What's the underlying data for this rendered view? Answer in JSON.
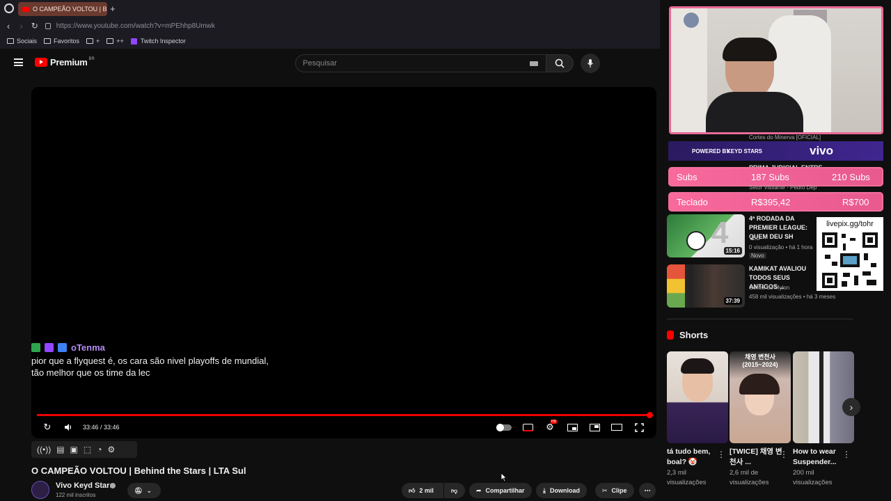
{
  "browser": {
    "tab_title": "O CAMPEÃO VOLTOU | Be",
    "new_tab": "+",
    "url": "https://www.youtube.com/watch?v=mPEhhp8Umwk",
    "bookmarks": [
      {
        "label": "Sociais"
      },
      {
        "label": "Favoritos"
      },
      {
        "label": "+"
      },
      {
        "label": "++"
      },
      {
        "label": "Twitch Inspector"
      }
    ]
  },
  "masthead": {
    "brand": "Premium",
    "region": "BR",
    "search_placeholder": "Pesquisar"
  },
  "player": {
    "chat_user": "oTenma",
    "chat_message": "pior que a flyquest é, os cara são nivel playoffs de mundial, tão melhor que os time da lec",
    "time": "33:46 / 33:46",
    "progress": 1.0,
    "settings_badge": "HD"
  },
  "video": {
    "title": "O CAMPEÃO VOLTOU | Behind the Stars | LTA Sul",
    "channel": "Vivo Keyd Stars",
    "subscribers": "122 mil inscritos",
    "likes": "2 mil",
    "share": "Compartilhar",
    "download": "Download",
    "clip": "Clipe"
  },
  "overlay": {
    "sponsor_left": "POWERED BY",
    "sponsor_mid": "KEYD STARS",
    "sponsor_right": "vivo",
    "subs_label": "Subs",
    "subs_current": "187 Subs",
    "subs_goal": "210 Subs",
    "goal_label": "Teclado",
    "goal_current": "R$395,42",
    "goal_target": "R$700",
    "qr_text": "livepix.gg/tohr"
  },
  "sidebar": {
    "partial_channel_1": "Cortes do Minerva [OFICIAL]",
    "partial_title_2": "PRIMA JUDICIAL ENTRE",
    "partial_channel_2": "Setor Visitante - Pedro Dep",
    "videos": [
      {
        "title": "4ª RODADA DA PREMIER LEAGUE: QUEM DEU SH",
        "channel": "VED",
        "meta": "0 visualização • há 1 hora",
        "badge": "Novo",
        "duration": "15:16"
      },
      {
        "title": "KAMIKAT AVALIOU TODOS SEUS ANTIGOS ...",
        "channel": "Cortes do Mylon",
        "meta": "458 mil visualizações • há 3 meses",
        "duration": "37:39"
      }
    ],
    "shorts_heading": "Shorts",
    "shorts": [
      {
        "title": "tá tudo bem, boal? 🤡",
        "views_a": "2,3 mil",
        "views_b": "visualizações"
      },
      {
        "title": "[TWICE] 채영 변천사 ...",
        "views_a": "2,6 mil de",
        "views_b": "visualizações"
      },
      {
        "title": "How to wear Suspender...",
        "views_a": "200 mil",
        "views_b": "visualizações"
      }
    ],
    "short_2_overlay": "채영 변천사 (2015~2024)"
  }
}
